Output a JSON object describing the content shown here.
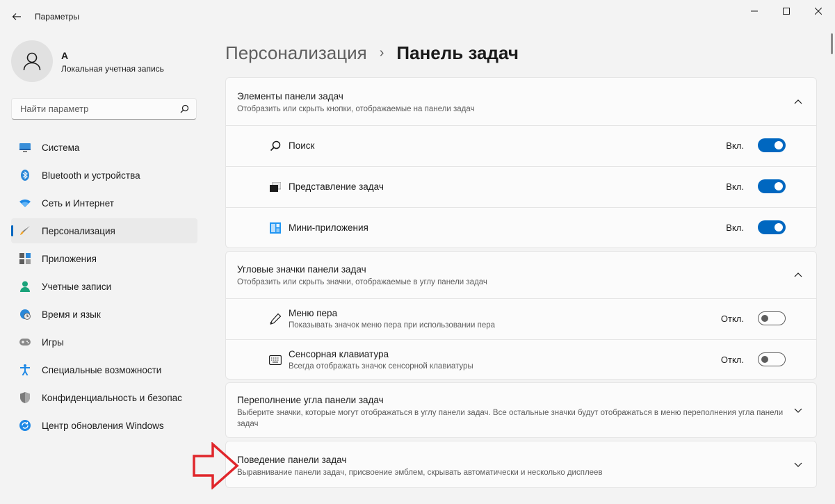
{
  "window": {
    "title": "Параметры",
    "back_icon": "arrow-left-icon",
    "minimize_icon": "minimize-icon",
    "maximize_icon": "maximize-icon",
    "close_icon": "close-icon"
  },
  "profile": {
    "name": "A",
    "account_type": "Локальная учетная запись",
    "avatar_icon": "person-icon"
  },
  "search": {
    "placeholder": "Найти параметр",
    "icon": "search-icon"
  },
  "sidebar": {
    "items": [
      {
        "label": "Система",
        "icon": "monitor-icon",
        "selected": false
      },
      {
        "label": "Bluetooth и устройства",
        "icon": "bluetooth-icon",
        "selected": false
      },
      {
        "label": "Сеть и Интернет",
        "icon": "wifi-icon",
        "selected": false
      },
      {
        "label": "Персонализация",
        "icon": "brush-icon",
        "selected": true
      },
      {
        "label": "Приложения",
        "icon": "apps-icon",
        "selected": false
      },
      {
        "label": "Учетные записи",
        "icon": "account-icon",
        "selected": false
      },
      {
        "label": "Время и язык",
        "icon": "globe-clock-icon",
        "selected": false
      },
      {
        "label": "Игры",
        "icon": "gamepad-icon",
        "selected": false
      },
      {
        "label": "Специальные возможности",
        "icon": "accessibility-icon",
        "selected": false
      },
      {
        "label": "Конфиденциальность и безопас",
        "icon": "shield-icon",
        "selected": false
      },
      {
        "label": "Центр обновления Windows",
        "icon": "update-icon",
        "selected": false
      }
    ]
  },
  "breadcrumb": {
    "parent": "Персонализация",
    "separator": "›",
    "current": "Панель задач"
  },
  "sections": {
    "taskbar_items": {
      "title": "Элементы панели задач",
      "description": "Отобразить или скрыть кнопки, отображаемые на панели задач",
      "expanded": true,
      "rows": [
        {
          "label": "Поиск",
          "state": "Вкл.",
          "on": true,
          "icon": "search-icon"
        },
        {
          "label": "Представление задач",
          "state": "Вкл.",
          "on": true,
          "icon": "task-view-icon"
        },
        {
          "label": "Мини-приложения",
          "state": "Вкл.",
          "on": true,
          "icon": "widgets-icon"
        }
      ]
    },
    "corner_icons": {
      "title": "Угловые значки панели задач",
      "description": "Отобразить или скрыть значки, отображаемые в углу панели задач",
      "expanded": true,
      "rows": [
        {
          "label": "Меню пера",
          "description": "Показывать значок меню пера при использовании пера",
          "state": "Откл.",
          "on": false,
          "icon": "pen-icon"
        },
        {
          "label": "Сенсорная клавиатура",
          "description": "Всегда отображать значок сенсорной клавиатуры",
          "state": "Откл.",
          "on": false,
          "icon": "keyboard-icon"
        }
      ]
    },
    "corner_overflow": {
      "title": "Переполнение угла панели задач",
      "description": "Выберите значки, которые могут отображаться в углу панели задач. Все остальные значки будут отображаться в меню переполнения угла панели задач",
      "expanded": false
    },
    "behaviors": {
      "title": "Поведение панели задач",
      "description": "Выравнивание панели задач, присвоение эмблем, скрывать автоматически и несколько дисплеев",
      "expanded": false
    }
  },
  "colors": {
    "accent": "#0067c0",
    "annotation_arrow": "#e0262b"
  }
}
